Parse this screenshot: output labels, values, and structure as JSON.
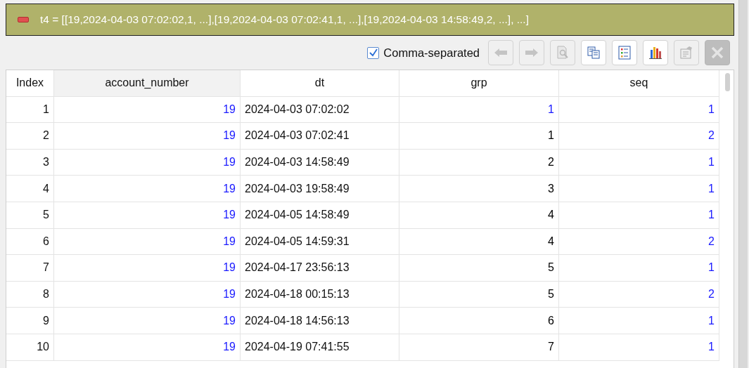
{
  "banner": {
    "text": "t4 = [[19,2024-04-03 07:02:02,1, ...],[19,2024-04-03 07:02:41,1, ...],[19,2024-04-03 14:58:49,2, ...], ...]"
  },
  "toolbar": {
    "checkbox": {
      "label": "Comma-separated",
      "checked": true
    },
    "buttons": [
      {
        "kind": "back",
        "disabled": true
      },
      {
        "kind": "forward",
        "disabled": true
      },
      {
        "kind": "preview",
        "disabled": true
      },
      {
        "kind": "copy",
        "disabled": false
      },
      {
        "kind": "list",
        "disabled": false
      },
      {
        "kind": "chart",
        "disabled": false
      },
      {
        "kind": "properties",
        "disabled": true
      },
      {
        "kind": "close",
        "disabled": true
      }
    ]
  },
  "table": {
    "columns": [
      "Index",
      "account_number",
      "dt",
      "grp",
      "seq"
    ],
    "rows": [
      {
        "index": "1",
        "account_number": {
          "text": "19",
          "color": "#1a1aff"
        },
        "dt": "2024-04-03 07:02:02",
        "grp": {
          "text": "1",
          "color": "#1a1aff"
        },
        "seq": {
          "text": "1",
          "color": "#1a1aff"
        }
      },
      {
        "index": "2",
        "account_number": {
          "text": "19",
          "color": "#1a1aff"
        },
        "dt": "2024-04-03 07:02:41",
        "grp": {
          "text": "1",
          "color": "#000000"
        },
        "seq": {
          "text": "2",
          "color": "#1a1aff"
        }
      },
      {
        "index": "3",
        "account_number": {
          "text": "19",
          "color": "#1a1aff"
        },
        "dt": "2024-04-03 14:58:49",
        "grp": {
          "text": "2",
          "color": "#000000"
        },
        "seq": {
          "text": "1",
          "color": "#1a1aff"
        }
      },
      {
        "index": "4",
        "account_number": {
          "text": "19",
          "color": "#1a1aff"
        },
        "dt": "2024-04-03 19:58:49",
        "grp": {
          "text": "3",
          "color": "#000000"
        },
        "seq": {
          "text": "1",
          "color": "#1a1aff"
        }
      },
      {
        "index": "5",
        "account_number": {
          "text": "19",
          "color": "#1a1aff"
        },
        "dt": "2024-04-05 14:58:49",
        "grp": {
          "text": "4",
          "color": "#000000"
        },
        "seq": {
          "text": "1",
          "color": "#1a1aff"
        }
      },
      {
        "index": "6",
        "account_number": {
          "text": "19",
          "color": "#1a1aff"
        },
        "dt": "2024-04-05 14:59:31",
        "grp": {
          "text": "4",
          "color": "#000000"
        },
        "seq": {
          "text": "2",
          "color": "#1a1aff"
        }
      },
      {
        "index": "7",
        "account_number": {
          "text": "19",
          "color": "#1a1aff"
        },
        "dt": "2024-04-17 23:56:13",
        "grp": {
          "text": "5",
          "color": "#000000"
        },
        "seq": {
          "text": "1",
          "color": "#1a1aff"
        }
      },
      {
        "index": "8",
        "account_number": {
          "text": "19",
          "color": "#1a1aff"
        },
        "dt": "2024-04-18 00:15:13",
        "grp": {
          "text": "5",
          "color": "#000000"
        },
        "seq": {
          "text": "2",
          "color": "#1a1aff"
        }
      },
      {
        "index": "9",
        "account_number": {
          "text": "19",
          "color": "#1a1aff"
        },
        "dt": "2024-04-18 14:56:13",
        "grp": {
          "text": "6",
          "color": "#000000"
        },
        "seq": {
          "text": "1",
          "color": "#1a1aff"
        }
      },
      {
        "index": "10",
        "account_number": {
          "text": "19",
          "color": "#1a1aff"
        },
        "dt": "2024-04-19 07:41:55",
        "grp": {
          "text": "7",
          "color": "#000000"
        },
        "seq": {
          "text": "1",
          "color": "#1a1aff"
        }
      }
    ]
  }
}
